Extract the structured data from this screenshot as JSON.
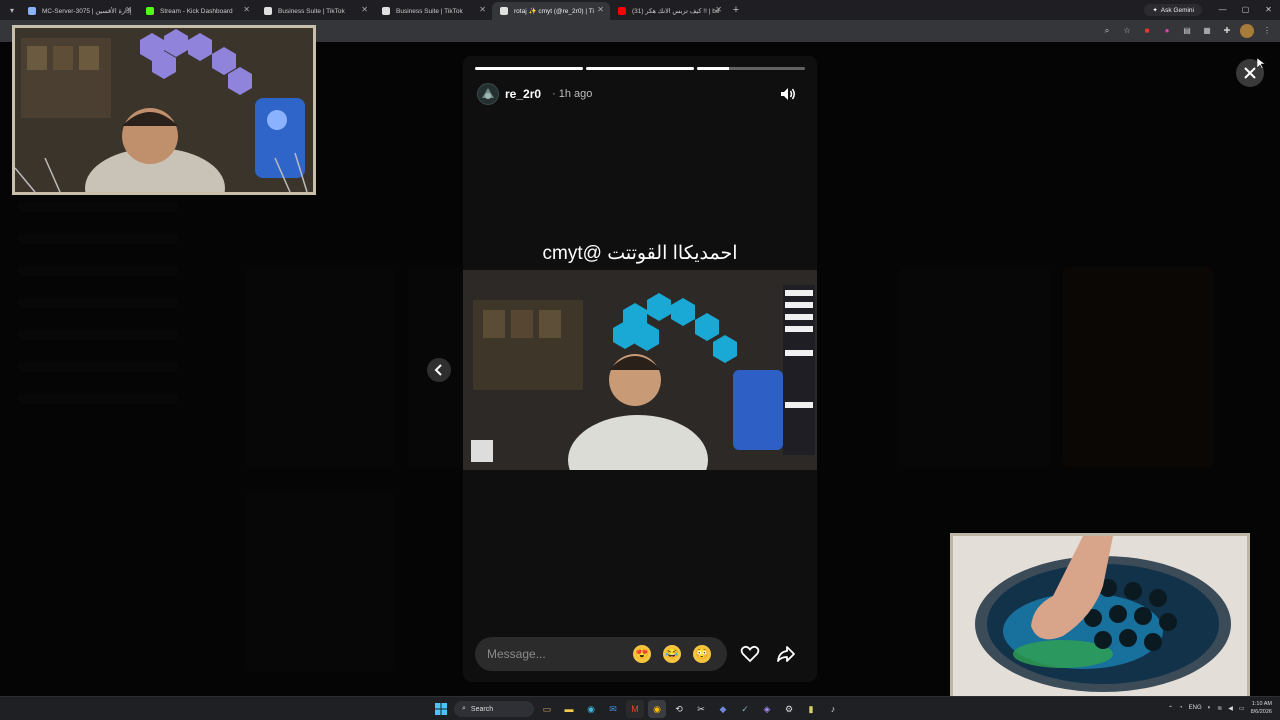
{
  "browser": {
    "tabs": [
      {
        "label": "MC-Server-3075 | إدارة الأقسين",
        "favicon_color": "#8ab4f8"
      },
      {
        "label": "Stream - Kick Dashboard",
        "favicon_color": "#53fc18"
      },
      {
        "label": "Business Suite | TikTok",
        "favicon_color": "#ffffff"
      },
      {
        "label": "Business Suite | TikTok",
        "favicon_color": "#ffffff"
      },
      {
        "label": "rotaj ✨ cmyt (@re_2r0) | Ti",
        "favicon_color": "#ffffff",
        "active": true
      },
      {
        "label": "(31) كيف تربس الانك هكر !! | be",
        "favicon_color": "#ff0000"
      }
    ],
    "new_tab_label": "+",
    "ask_gemini_label": "Ask Gemini",
    "window_controls": {
      "minimize": "—",
      "maximize": "▢",
      "close": "✕"
    }
  },
  "story": {
    "username": "re_2r0",
    "time": "· 1h ago",
    "progress": [
      1.0,
      1.0,
      0.3
    ],
    "caption": "احمديكاا القوتتت @cmyt",
    "message_placeholder": "Message...",
    "emojis": [
      "😍",
      "😂",
      "😳"
    ],
    "icons": {
      "sound": "speaker-icon",
      "like": "heart-icon",
      "share": "share-icon",
      "prev": "chevron-left-icon",
      "close": "close-icon"
    }
  },
  "taskbar": {
    "search_label": "Search",
    "language": "ENG",
    "time": "1:10 AM",
    "date": "8/6/2026"
  },
  "colors": {
    "story_bg": "#0f0f0f",
    "overlay": "#000000",
    "accent_red": "#fe2c55"
  }
}
